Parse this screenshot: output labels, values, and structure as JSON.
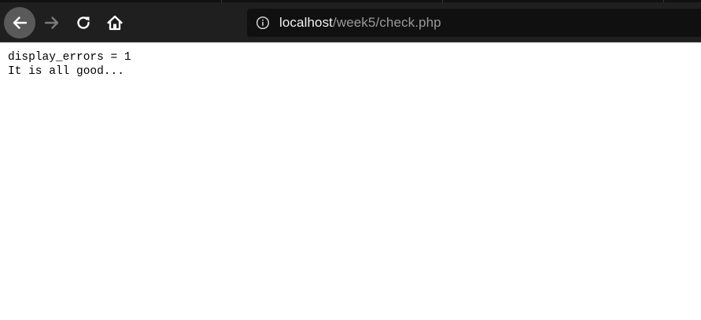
{
  "browser": {
    "back_icon": "arrow-left-icon",
    "forward_icon": "arrow-right-icon",
    "reload_icon": "reload-icon",
    "home_icon": "home-icon",
    "info_icon": "info-icon",
    "url_host": "localhost",
    "url_path": "/week5/check.php",
    "colors": {
      "toolbar": "#1f1f1f",
      "omnibox": "#101010",
      "url_host": "#f1f1f1",
      "url_path": "#9a9a9a"
    }
  },
  "page": {
    "lines": [
      "display_errors = 1",
      "It is all good..."
    ]
  }
}
